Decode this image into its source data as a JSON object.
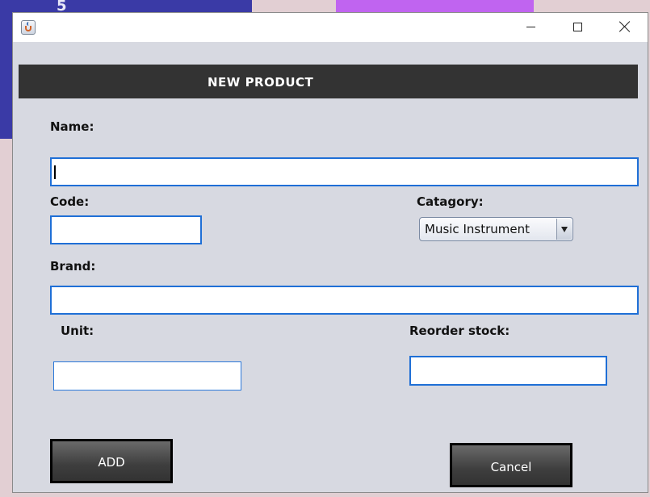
{
  "background": {
    "partial_label": "5"
  },
  "window": {
    "controls": {
      "minimize": "minimize-icon",
      "maximize": "maximize-icon",
      "close": "close-icon"
    }
  },
  "form": {
    "title": "NEW PRODUCT",
    "name_label": "Name:",
    "name_value": "",
    "code_label": "Code:",
    "code_value": "",
    "category_label": "Catagory:",
    "category_value": "Music Instrument",
    "brand_label": "Brand:",
    "brand_value": "",
    "unit_label": "Unit:",
    "unit_value": "",
    "reorder_label": "Reorder stock:",
    "reorder_value": "",
    "add_label": "ADD",
    "cancel_label": "Cancel"
  },
  "colors": {
    "header_bg": "#333333",
    "form_bg": "#d7d9e1",
    "field_border": "#1f6fd6",
    "button_bg": "#444444"
  }
}
